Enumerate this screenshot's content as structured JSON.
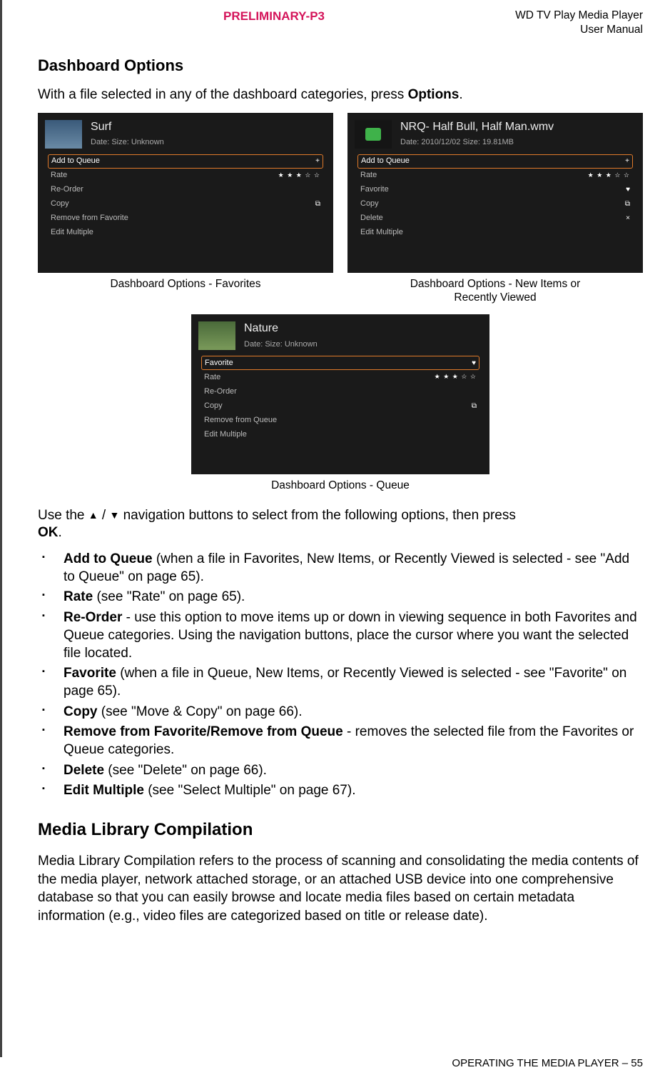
{
  "header": {
    "preliminary": "PRELIMINARY-P3",
    "product_line1": "WD TV Play Media Player",
    "product_line2": "User Manual"
  },
  "section_title": "Dashboard Options",
  "intro_pre": "With a file selected in any of the dashboard categories, press ",
  "intro_bold": "Options",
  "intro_post": ".",
  "shot_fav": {
    "title": "Surf",
    "meta": "Date:          Size: Unknown",
    "caption": "Dashboard Options - Favorites",
    "rows": {
      "sel": "Add to Queue",
      "sel_icon": "+",
      "rate": "Rate",
      "stars": "★ ★ ★ ☆ ☆",
      "reorder": "Re-Order",
      "copy": "Copy",
      "copy_icon": "⧉",
      "remove": "Remove from Favorite",
      "edit": "Edit Multiple"
    }
  },
  "shot_new": {
    "title": "NRQ- Half Bull, Half Man.wmv",
    "meta": "Date: 2010/12/02    Size: 19.81MB",
    "caption_l1": "Dashboard Options - New Items or",
    "caption_l2": "Recently Viewed",
    "rows": {
      "sel": "Add to Queue",
      "sel_icon": "+",
      "rate": "Rate",
      "stars": "★ ★ ★ ☆ ☆",
      "fav": "Favorite",
      "fav_icon": "♥",
      "copy": "Copy",
      "copy_icon": "⧉",
      "delete": "Delete",
      "delete_icon": "×",
      "edit": "Edit Multiple"
    }
  },
  "shot_queue": {
    "title": "Nature",
    "meta": "Date:          Size: Unknown",
    "caption": "Dashboard Options - Queue",
    "rows": {
      "sel": "Favorite",
      "sel_icon": "♥",
      "rate": "Rate",
      "stars": "★ ★ ★ ☆ ☆",
      "reorder": "Re-Order",
      "copy": "Copy",
      "copy_icon": "⧉",
      "remove": "Remove from Queue",
      "edit": "Edit Multiple"
    }
  },
  "nav_pre": "Use the ",
  "nav_mid": " navigation buttons to select from the following options, then press ",
  "nav_ok": "OK",
  "nav_post": ".",
  "bullets": {
    "b1_bold": "Add to Queue",
    "b1_rest": " (when a file in Favorites, New Items, or Recently Viewed is selected - see \"Add to Queue\" on page 65).",
    "b2_bold": "Rate",
    "b2_rest": " (see \"Rate\" on page 65).",
    "b3_bold": "Re-Order",
    "b3_rest": " - use this option to move items up or down in viewing sequence in both Favorites and Queue categories. Using the navigation buttons, place the cursor where you want the selected file located.",
    "b4_bold": "Favorite",
    "b4_rest": " (when a file in Queue, New Items, or Recently Viewed is selected - see \"Favorite\" on page 65).",
    "b5_bold": "Copy",
    "b5_rest": " (see \"Move & Copy\" on page 66).",
    "b6_bold": "Remove from Favorite/Remove from Queue",
    "b6_rest": " - removes the selected file from the Favorites or Queue categories.",
    "b7_bold": "Delete",
    "b7_rest": " (see \"Delete\" on page 66).",
    "b8_bold": "Edit Multiple",
    "b8_rest": " (see \"Select Multiple\" on page 67)."
  },
  "mlc_title": "Media Library Compilation",
  "mlc_body": "Media Library Compilation refers to the process of scanning and consolidating the media contents of the media player, network attached storage, or an attached USB device into one comprehensive database so that you can easily browse and locate media files based on certain metadata information (e.g., video files are categorized based on title or release date).",
  "footer": "OPERATING THE MEDIA PLAYER – 55"
}
